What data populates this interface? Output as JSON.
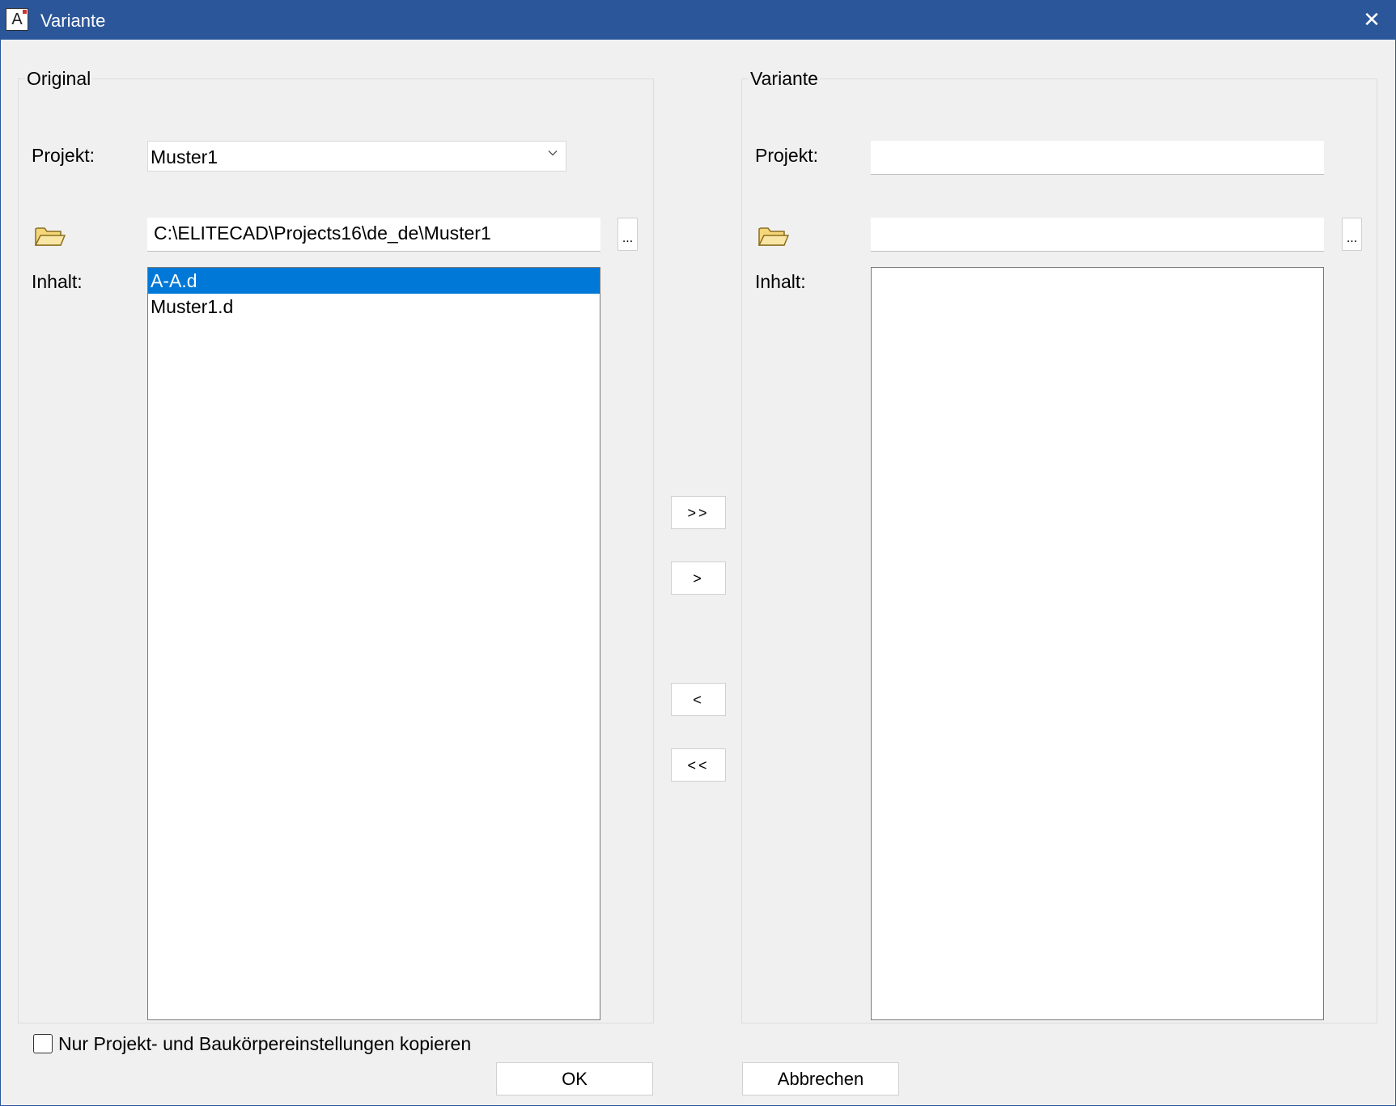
{
  "titlebar": {
    "title": "Variante",
    "app_icon_glyph": "A",
    "close_glyph": "✕"
  },
  "original": {
    "group_title": "Original",
    "project_label": "Projekt:",
    "project_value": "Muster1",
    "path_value": "C:\\ELITECAD\\Projects16\\de_de\\Muster1",
    "browse_label": "...",
    "content_label": "Inhalt:",
    "items": [
      "A-A.d",
      "Muster1.d"
    ],
    "selected_item": "A-A.d"
  },
  "variante": {
    "group_title": "Variante",
    "project_label": "Projekt:",
    "project_value": "",
    "path_value": "",
    "browse_label": "...",
    "content_label": "Inhalt:",
    "items": []
  },
  "transfer": {
    "add_all": ">>",
    "add_one": ">",
    "remove_one": "<",
    "remove_all": "<<"
  },
  "options": {
    "copy_settings_only_label": "Nur Projekt- und Baukörpereinstellungen kopieren",
    "copy_settings_only_checked": false
  },
  "buttons": {
    "ok": "OK",
    "cancel": "Abbrechen"
  },
  "colors": {
    "titlebar": "#2b579a",
    "selection": "#0078d7",
    "folder": "#f5d77a"
  }
}
